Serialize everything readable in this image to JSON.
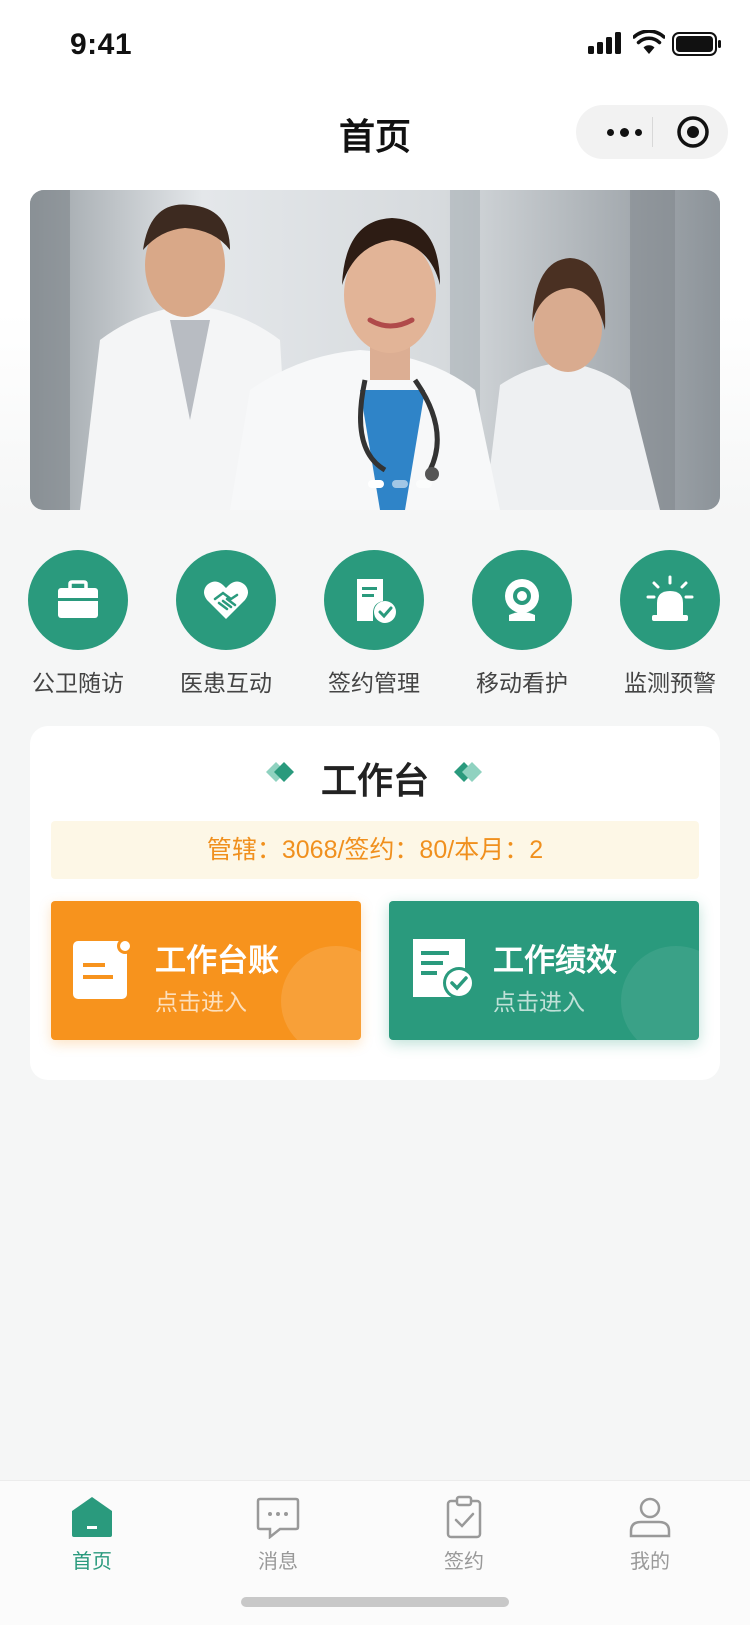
{
  "status_bar": {
    "time": "9:41"
  },
  "nav": {
    "title": "首页",
    "more_icon": "more-dots-icon",
    "close_icon": "target-icon"
  },
  "banner": {
    "slides": 3,
    "active_slide": 1
  },
  "quick_actions": [
    {
      "label": "公卫随访",
      "icon": "medical-bag-icon"
    },
    {
      "label": "医患互动",
      "icon": "heart-handshake-icon"
    },
    {
      "label": "签约管理",
      "icon": "document-check-icon"
    },
    {
      "label": "移动看护",
      "icon": "webcam-icon"
    },
    {
      "label": "监测预警",
      "icon": "alarm-siren-icon"
    }
  ],
  "workbench": {
    "title": "工作台",
    "stats": "管辖：3068/签约：80/本月：2",
    "ledger": {
      "title": "工作台账",
      "subtitle": "点击进入"
    },
    "performance": {
      "title": "工作绩效",
      "subtitle": "点击进入"
    }
  },
  "tabbar": {
    "items": [
      {
        "label": "首页",
        "icon": "home-icon",
        "active": true
      },
      {
        "label": "消息",
        "icon": "message-icon",
        "active": false
      },
      {
        "label": "签约",
        "icon": "clipboard-check-icon",
        "active": false
      },
      {
        "label": "我的",
        "icon": "user-icon",
        "active": false
      }
    ]
  },
  "colors": {
    "primary": "#2a9a7d",
    "orange": "#f7931d",
    "stat_bg": "#fdf7e6",
    "stat_text": "#f0901e"
  }
}
